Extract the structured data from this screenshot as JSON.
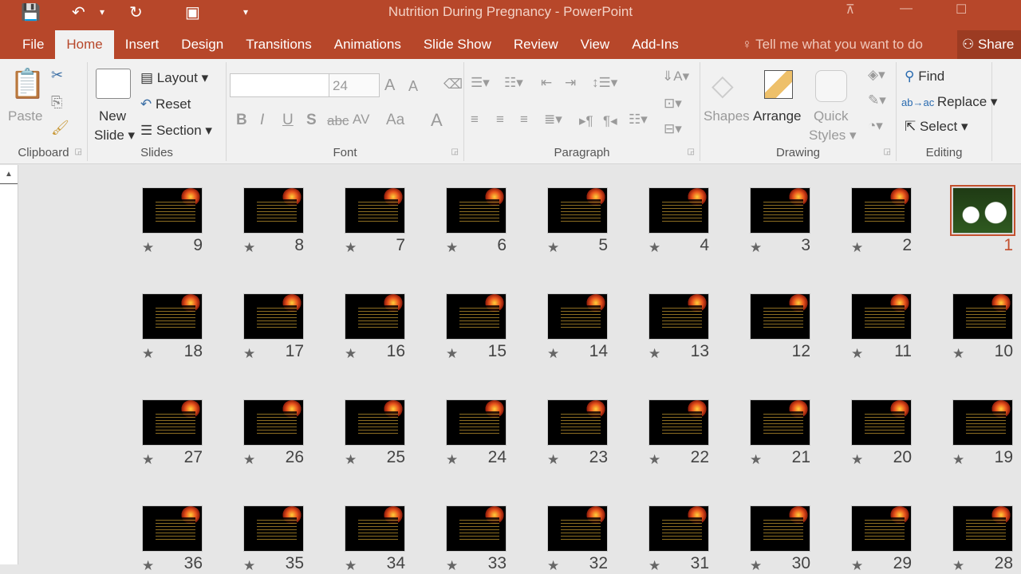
{
  "window": {
    "title": "Nutrition During Pregnancy - PowerPoint"
  },
  "qat": {
    "save": "💾",
    "undo": "↶",
    "undo_dd": "▾",
    "redo": "↻",
    "present": "▣",
    "customize": "▾"
  },
  "tabs": [
    {
      "label": "File"
    },
    {
      "label": "Home",
      "active": true
    },
    {
      "label": "Insert"
    },
    {
      "label": "Design"
    },
    {
      "label": "Transitions"
    },
    {
      "label": "Animations"
    },
    {
      "label": "Slide Show"
    },
    {
      "label": "Review"
    },
    {
      "label": "View"
    },
    {
      "label": "Add-Ins"
    }
  ],
  "tell_me": "Tell me what you want to do",
  "share": "Share",
  "ribbon": {
    "clipboard": {
      "label": "Clipboard",
      "paste": "Paste"
    },
    "slides": {
      "label": "Slides",
      "new_slide_1": "New",
      "new_slide_2": "Slide",
      "layout": "Layout",
      "reset": "Reset",
      "section": "Section"
    },
    "font": {
      "label": "Font",
      "font_name": "",
      "font_size": "24",
      "bold": "B",
      "italic": "I",
      "underline": "U",
      "shadow": "S",
      "strike": "abc",
      "spacing": "AV",
      "case": "Aa",
      "color": "A",
      "grow": "A",
      "shrink": "A"
    },
    "paragraph": {
      "label": "Paragraph"
    },
    "drawing": {
      "label": "Drawing",
      "shapes": "Shapes",
      "arrange": "Arrange",
      "quick_1": "Quick",
      "quick_2": "Styles"
    },
    "editing": {
      "label": "Editing",
      "find": "Find",
      "replace": "Replace",
      "select": "Select"
    }
  },
  "colors": {
    "accent": "#b7472a",
    "selected": "#c3502e"
  },
  "slides": [
    {
      "n": "9",
      "star": true
    },
    {
      "n": "8",
      "star": true
    },
    {
      "n": "7",
      "star": true
    },
    {
      "n": "6",
      "star": true
    },
    {
      "n": "5",
      "star": true
    },
    {
      "n": "4",
      "star": true
    },
    {
      "n": "3",
      "star": true
    },
    {
      "n": "2",
      "star": true
    },
    {
      "n": "1",
      "star": false,
      "selected": true,
      "image": "flower"
    },
    {
      "n": "18",
      "star": true
    },
    {
      "n": "17",
      "star": true
    },
    {
      "n": "16",
      "star": true
    },
    {
      "n": "15",
      "star": true
    },
    {
      "n": "14",
      "star": true
    },
    {
      "n": "13",
      "star": true
    },
    {
      "n": "12",
      "star": false
    },
    {
      "n": "11",
      "star": true
    },
    {
      "n": "10",
      "star": true
    },
    {
      "n": "27",
      "star": true
    },
    {
      "n": "26",
      "star": true
    },
    {
      "n": "25",
      "star": true
    },
    {
      "n": "24",
      "star": true
    },
    {
      "n": "23",
      "star": true
    },
    {
      "n": "22",
      "star": true
    },
    {
      "n": "21",
      "star": true
    },
    {
      "n": "20",
      "star": true
    },
    {
      "n": "19",
      "star": true
    },
    {
      "n": "36",
      "star": true
    },
    {
      "n": "35",
      "star": true
    },
    {
      "n": "34",
      "star": true
    },
    {
      "n": "33",
      "star": true
    },
    {
      "n": "32",
      "star": true
    },
    {
      "n": "31",
      "star": true
    },
    {
      "n": "30",
      "star": true
    },
    {
      "n": "29",
      "star": true
    },
    {
      "n": "28",
      "star": true
    }
  ]
}
